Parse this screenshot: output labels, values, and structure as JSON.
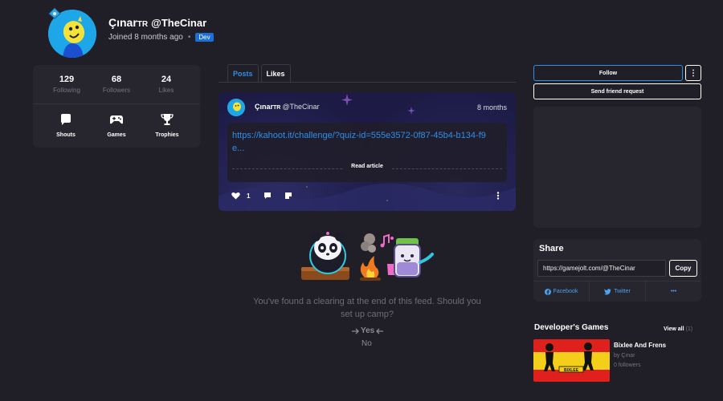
{
  "profile": {
    "display_name": "Çınar",
    "display_suffix": "TR",
    "username": "@TheCinar",
    "joined": "Joined 8 months ago",
    "badge": "Dev"
  },
  "stats": [
    {
      "value": "129",
      "label": "Following"
    },
    {
      "value": "68",
      "label": "Followers"
    },
    {
      "value": "24",
      "label": "Likes"
    }
  ],
  "nav": [
    {
      "label": "Shouts",
      "icon": "chat-bubble-icon"
    },
    {
      "label": "Games",
      "icon": "gamepad-icon"
    },
    {
      "label": "Trophies",
      "icon": "trophy-icon"
    }
  ],
  "tabs": [
    {
      "label": "Posts",
      "active": true
    },
    {
      "label": "Likes",
      "active": false
    }
  ],
  "post": {
    "author": "Çınar",
    "author_suffix": "TR",
    "author_username": "@TheCinar",
    "time": "8 months",
    "link": "https://kahoot.it/challenge/?quiz-id=555e3572-0f87-45b4-b134-f9e...",
    "read_more": "Read article",
    "likes": "1"
  },
  "feed_end": {
    "text": "You've found a clearing at the end of this feed. Should you set up camp?",
    "yes": "Yes",
    "no": "No"
  },
  "actions": {
    "follow": "Follow",
    "more": "⋮",
    "friend_request": "Send friend request"
  },
  "share": {
    "title": "Share",
    "url": "https://gamejolt.com/@TheCinar",
    "copy": "Copy",
    "facebook": "Facebook",
    "twitter": "Twitter",
    "more": "•••"
  },
  "dev_games": {
    "title": "Developer's Games",
    "view_all": "View all",
    "count": "(1)",
    "game_title": "Bixlee And Frens",
    "game_by": "by Çınar",
    "game_followers": "0 followers",
    "thumb_text": "BIXLEE"
  },
  "colors": {
    "background": "#201e27",
    "card": "#27252e",
    "accent_blue": "#2f8fe6",
    "avatar_blue": "#1ea7e8"
  }
}
